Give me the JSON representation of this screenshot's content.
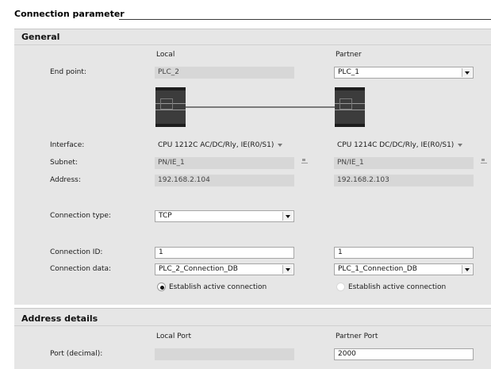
{
  "title": "Connection parameter",
  "general": {
    "heading": "General",
    "col_local": "Local",
    "col_partner": "Partner",
    "endpoint": {
      "label": "End point:",
      "local": "PLC_2",
      "partner": "PLC_1"
    },
    "interface": {
      "label": "Interface:",
      "local": "CPU 1212C AC/DC/Rly, IE(R0/S1)",
      "partner": "CPU 1214C DC/DC/Rly, IE(R0/S1)"
    },
    "subnet": {
      "label": "Subnet:",
      "local": "PN/IE_1",
      "partner": "PN/IE_1"
    },
    "address": {
      "label": "Address:",
      "local": "192.168.2.104",
      "partner": "192.168.2.103"
    },
    "conn_type": {
      "label": "Connection type:",
      "value": "TCP"
    },
    "conn_id": {
      "label": "Connection ID:",
      "local": "1",
      "partner": "1"
    },
    "conn_data": {
      "label": "Connection data:",
      "local": "PLC_2_Connection_DB",
      "partner": "PLC_1_Connection_DB"
    },
    "establish": {
      "local": "Establish active connection",
      "partner": "Establish active connection",
      "local_checked": true,
      "partner_checked": false
    }
  },
  "address_details": {
    "heading": "Address details",
    "col_local": "Local Port",
    "col_partner": "Partner Port",
    "port": {
      "label": "Port (decimal):",
      "local": "",
      "partner": "2000"
    }
  },
  "icons": [
    "dropdown-arrow-icon",
    "subnet-icon",
    "plc-icon",
    "radio-icon"
  ],
  "colors": {
    "panel": "#e6e6e6",
    "readonly_field": "#d7d7d7",
    "input_field": "#ffffff",
    "plc_body": "#3c3c3c"
  }
}
